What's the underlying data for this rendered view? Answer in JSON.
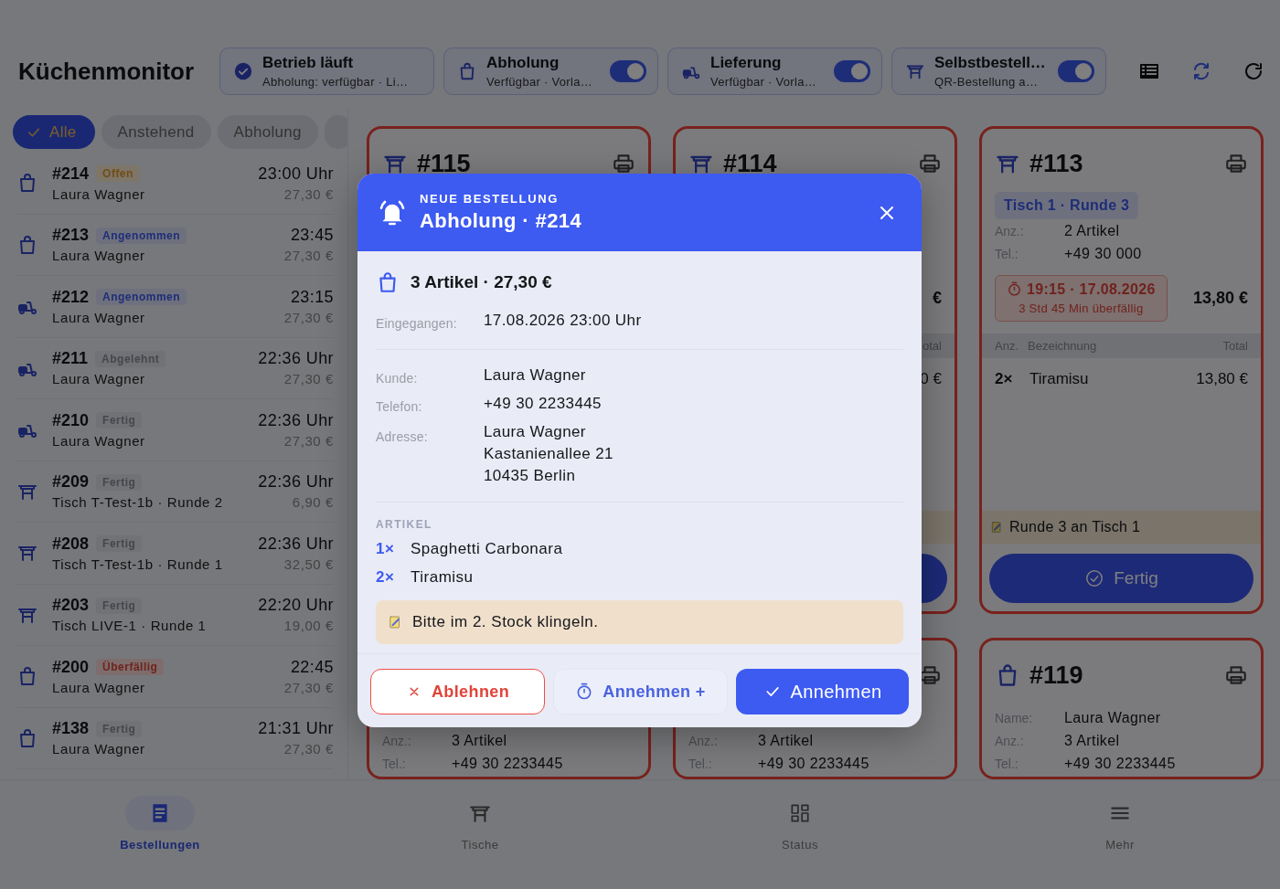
{
  "header": {
    "title": "Küchenmonitor",
    "status_chips": [
      {
        "kind": "status",
        "title": "Betrieb läuft",
        "subtitle": "Abholung: verfügbar · Li…"
      },
      {
        "kind": "pickup",
        "title": "Abholung",
        "subtitle": "Verfügbar · Vorla…",
        "on": true
      },
      {
        "kind": "delivery",
        "title": "Lieferung",
        "subtitle": "Verfügbar · Vorla…",
        "on": true
      },
      {
        "kind": "table",
        "title": "Selbstbestell…",
        "subtitle": "QR-Bestellung a…",
        "on": true
      }
    ]
  },
  "filters": [
    {
      "label": "Alle",
      "selected": true
    },
    {
      "label": "Anstehend",
      "selected": false
    },
    {
      "label": "Abholung",
      "selected": false
    }
  ],
  "orders": [
    {
      "kind": "pickup",
      "number": "#214",
      "status": {
        "label": "Offen",
        "kind": "pending"
      },
      "name": "Laura Wagner",
      "time": "23:00 Uhr",
      "price": "27,30 €"
    },
    {
      "kind": "pickup",
      "number": "#213",
      "status": {
        "label": "Angenommen",
        "kind": "accepted"
      },
      "name": "Laura Wagner",
      "time": "23:45",
      "price": "27,30 €"
    },
    {
      "kind": "delivery",
      "number": "#212",
      "status": {
        "label": "Angenommen",
        "kind": "accepted"
      },
      "name": "Laura Wagner",
      "time": "23:15",
      "price": "27,30 €"
    },
    {
      "kind": "delivery",
      "number": "#211",
      "status": {
        "label": "Abgelehnt",
        "kind": "neutral"
      },
      "name": "Laura Wagner",
      "time": "22:36 Uhr",
      "price": "27,30 €"
    },
    {
      "kind": "delivery",
      "number": "#210",
      "status": {
        "label": "Fertig",
        "kind": "neutral"
      },
      "name": "Laura Wagner",
      "time": "22:36 Uhr",
      "price": "27,30 €"
    },
    {
      "kind": "table",
      "number": "#209",
      "status": {
        "label": "Fertig",
        "kind": "neutral"
      },
      "name": "Tisch T-Test-1b · Runde 2",
      "time": "22:36 Uhr",
      "price": "6,90 €"
    },
    {
      "kind": "table",
      "number": "#208",
      "status": {
        "label": "Fertig",
        "kind": "neutral"
      },
      "name": "Tisch T-Test-1b · Runde 1",
      "time": "22:36 Uhr",
      "price": "32,50 €"
    },
    {
      "kind": "table",
      "number": "#203",
      "status": {
        "label": "Fertig",
        "kind": "neutral"
      },
      "name": "Tisch LIVE-1 · Runde 1",
      "time": "22:20 Uhr",
      "price": "19,00 €"
    },
    {
      "kind": "pickup",
      "number": "#200",
      "status": {
        "label": "Überfällig",
        "kind": "overdue"
      },
      "name": "Laura Wagner",
      "time": "22:45",
      "price": "27,30 €"
    },
    {
      "kind": "pickup",
      "number": "#138",
      "status": {
        "label": "Fertig",
        "kind": "neutral"
      },
      "name": "Laura Wagner",
      "time": "21:31 Uhr",
      "price": "27,30 €"
    }
  ],
  "cards_top": [
    {
      "kind": "table",
      "number": "#115"
    },
    {
      "kind": "table",
      "number": "#114",
      "price": "€",
      "columns": {
        "total": "otal"
      },
      "lines": [
        {
          "total": "0 €"
        }
      ]
    },
    {
      "kind": "table",
      "number": "#113",
      "tag": "Tisch 1 · Runde 3",
      "fields": [
        {
          "label": "Anz.:",
          "value": "2 Artikel"
        },
        {
          "label": "Tel.:",
          "value": "+49 30 000"
        }
      ],
      "due": {
        "time": "19:15 · 17.08.2026",
        "late": "3 Std 45 Min überfällig"
      },
      "price": "13,80 €",
      "columns": {
        "qty": "Anz.",
        "name": "Bezeichnung",
        "total": "Total"
      },
      "lines": [
        {
          "qty": "2×",
          "name": "Tiramisu",
          "total": "13,80 €"
        }
      ],
      "note": "Runde 3 an Tisch 1",
      "action": "Fertig"
    }
  ],
  "cards_bottom": [
    {
      "fields": [
        {
          "label": "Anz.:",
          "value": "3 Artikel"
        },
        {
          "label": "Tel.:",
          "value": "+49 30 2233445"
        }
      ]
    },
    {
      "fields": [
        {
          "label": "Anz.:",
          "value": "3 Artikel"
        },
        {
          "label": "Tel.:",
          "value": "+49 30 2233445"
        }
      ]
    },
    {
      "kind": "pickup",
      "number": "#119",
      "fields": [
        {
          "label": "Name:",
          "value": "Laura Wagner"
        },
        {
          "label": "Anz.:",
          "value": "3 Artikel"
        },
        {
          "label": "Tel.:",
          "value": "+49 30 2233445"
        }
      ]
    }
  ],
  "nav": [
    {
      "label": "Bestellungen",
      "selected": true
    },
    {
      "label": "Tische",
      "selected": false
    },
    {
      "label": "Status",
      "selected": false
    },
    {
      "label": "Mehr",
      "selected": false
    }
  ],
  "dialog": {
    "eyebrow": "NEUE BESTELLUNG",
    "title": "Abholung · #214",
    "summary": "3 Artikel · 27,30 €",
    "received": {
      "label": "Eingegangen:",
      "value": "17.08.2026 23:00 Uhr"
    },
    "customer": [
      {
        "label": "Kunde:",
        "lines": [
          "Laura Wagner"
        ]
      },
      {
        "label": "Telefon:",
        "lines": [
          "+49 30 2233445"
        ]
      },
      {
        "label": "Adresse:",
        "lines": [
          "Laura Wagner",
          "Kastanienallee 21",
          "10435 Berlin"
        ]
      }
    ],
    "items_label": "ARTIKEL",
    "items": [
      {
        "qty": "1×",
        "name": "Spaghetti Carbonara"
      },
      {
        "qty": "2×",
        "name": "Tiramisu"
      }
    ],
    "note": "Bitte im 2. Stock klingeln.",
    "actions": [
      {
        "kind": "reject",
        "label": "Ablehnen"
      },
      {
        "kind": "defer",
        "label": "Annehmen +"
      },
      {
        "kind": "accept",
        "label": "Annehmen"
      }
    ]
  }
}
